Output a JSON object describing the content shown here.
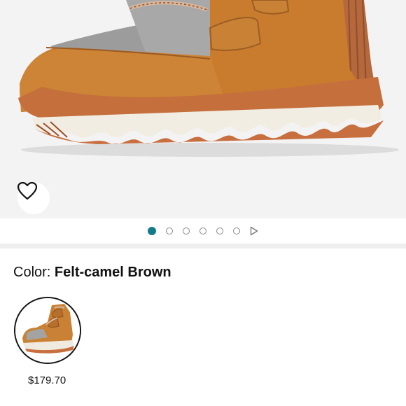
{
  "product": {
    "image_name": "shoe-image",
    "color_label": "Color:",
    "color_value": "Felt-camel Brown"
  },
  "carousel": {
    "page_count": 6,
    "active_index": 0,
    "play_icon": "play-icon",
    "active_color": "#127c8c"
  },
  "favorite": {
    "icon": "heart-icon"
  },
  "swatches": [
    {
      "price": "$179.70",
      "selected": true
    }
  ]
}
